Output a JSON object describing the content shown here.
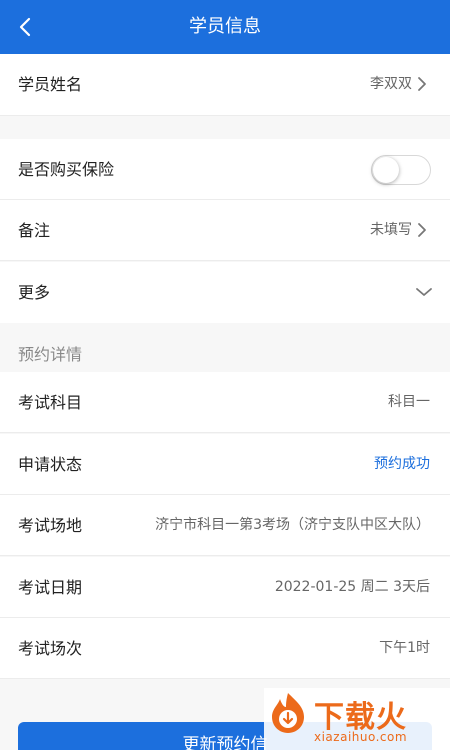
{
  "header": {
    "title": "学员信息"
  },
  "student": {
    "name_label": "学员姓名",
    "name_value": "李双双",
    "insurance_label": "是否购买保险",
    "insurance_on": false,
    "remark_label": "备注",
    "remark_value": "未填写",
    "more_label": "更多"
  },
  "booking": {
    "section_title": "预约详情",
    "rows": [
      {
        "label": "考试科目",
        "value": "科目一"
      },
      {
        "label": "申请状态",
        "value": "预约成功"
      },
      {
        "label": "考试场地",
        "value": "济宁市科目一第3考场（济宁支队中区大队）"
      },
      {
        "label": "考试日期",
        "value": "2022-01-25 周二 3天后"
      },
      {
        "label": "考试场次",
        "value": "下午1时"
      }
    ]
  },
  "cta": {
    "label": "更新预约信"
  },
  "watermark": {
    "brand": "下载火",
    "domain": "xiazaihuo.com"
  },
  "colors": {
    "primary": "#1c6fdd",
    "accent": "#1c6fdd",
    "watermark": "#ec6a1a"
  }
}
